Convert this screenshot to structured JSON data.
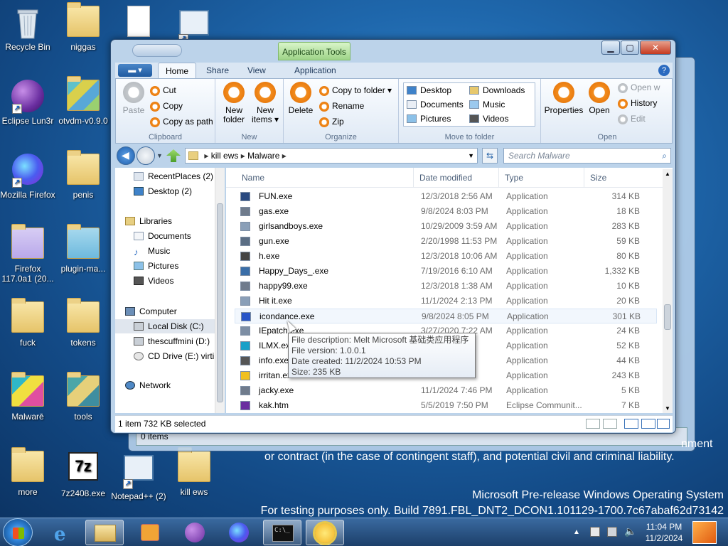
{
  "desktop": {
    "icons": [
      {
        "id": "recycle",
        "label": "Recycle Bin"
      },
      {
        "id": "niggas",
        "label": "niggas"
      },
      {
        "id": "eclipse",
        "label": "Eclipse Lun3r"
      },
      {
        "id": "otvdm",
        "label": "otvdm-v0.9.0"
      },
      {
        "id": "firefox",
        "label": "Mozilla Firefox"
      },
      {
        "id": "penis",
        "label": "penis"
      },
      {
        "id": "firefox117",
        "label": "Firefox 117.0a1 (20..."
      },
      {
        "id": "plugin",
        "label": "plugin-ma..."
      },
      {
        "id": "fuck",
        "label": "fuck"
      },
      {
        "id": "tokens",
        "label": "tokens"
      },
      {
        "id": "malware",
        "label": "Malwarē"
      },
      {
        "id": "tools",
        "label": "tools"
      },
      {
        "id": "more",
        "label": "more"
      },
      {
        "id": "7z",
        "label": "7z2408.exe"
      },
      {
        "id": "notepad",
        "label": "Notepad++ (2)"
      },
      {
        "id": "killews",
        "label": "kill ews"
      }
    ],
    "bg_status": "0 items",
    "bg_text_line1": "nment",
    "bg_text_line2": "or contract (in the case of contingent staff), and potential civil and criminal liability.",
    "watermark_line1": "Microsoft Pre-release Windows Operating System",
    "watermark_line2": "For testing purposes only. Build 7891.FBL_DNT2_DCON1.101129-1700.7c67abaf62d73142"
  },
  "window": {
    "context_tab": "Application Tools",
    "tabs": {
      "file": "▾",
      "home": "Home",
      "share": "Share",
      "view": "View",
      "application": "Application"
    },
    "clipboard": {
      "paste": "Paste",
      "cut": "Cut",
      "copy": "Copy",
      "copy_path": "Copy as path",
      "label": "Clipboard"
    },
    "new": {
      "folder": "New folder",
      "items": "New items ▾",
      "label": "New"
    },
    "organize": {
      "delete": "Delete",
      "copy_to": "Copy to folder ▾",
      "rename": "Rename",
      "zip": "Zip",
      "label": "Organize"
    },
    "move_to": {
      "desktop": "Desktop",
      "downloads": "Downloads",
      "documents": "Documents",
      "music": "Music",
      "pictures": "Pictures",
      "videos": "Videos",
      "label": "Move to folder"
    },
    "open": {
      "properties": "Properties",
      "open": "Open",
      "open_with": "Open w",
      "history": "History",
      "edit": "Edit",
      "label": "Open"
    },
    "path": {
      "part1": "kill ews",
      "part2": "Malware"
    },
    "search_placeholder": "Search Malware",
    "nav": {
      "recent": "RecentPlaces (2)",
      "desktop": "Desktop (2)",
      "libraries": "Libraries",
      "documents": "Documents",
      "music": "Music",
      "pictures": "Pictures",
      "videos": "Videos",
      "computer": "Computer",
      "local_disk": "Local Disk (C:)",
      "thescuff": "thescuffmini (D:)",
      "cd": "CD Drive (E:) virti",
      "network": "Network"
    },
    "columns": {
      "name": "Name",
      "date": "Date modified",
      "type": "Type",
      "size": "Size"
    },
    "files": [
      {
        "name": "FUN.exe",
        "date": "12/3/2018 2:56 AM",
        "type": "Application",
        "size": "314 KB"
      },
      {
        "name": "gas.exe",
        "date": "9/8/2024 8:03 PM",
        "type": "Application",
        "size": "18 KB"
      },
      {
        "name": "girlsandboys.exe",
        "date": "10/29/2009 3:59 AM",
        "type": "Application",
        "size": "283 KB"
      },
      {
        "name": "gun.exe",
        "date": "2/20/1998 11:53 PM",
        "type": "Application",
        "size": "59 KB"
      },
      {
        "name": "h.exe",
        "date": "12/3/2018 10:06 AM",
        "type": "Application",
        "size": "80 KB"
      },
      {
        "name": "Happy_Days_.exe",
        "date": "7/19/2016 6:10 AM",
        "type": "Application",
        "size": "1,332 KB"
      },
      {
        "name": "happy99.exe",
        "date": "12/3/2018 1:38 AM",
        "type": "Application",
        "size": "10 KB"
      },
      {
        "name": "Hit it.exe",
        "date": "11/1/2024 2:13 PM",
        "type": "Application",
        "size": "20 KB"
      },
      {
        "name": "icondance.exe",
        "date": "9/8/2024 8:05 PM",
        "type": "Application",
        "size": "301 KB"
      },
      {
        "name": "IEpatch.exe",
        "date": "3/27/2020 7:22 AM",
        "type": "Application",
        "size": "24 KB"
      },
      {
        "name": "ILMX.exe",
        "date": "",
        "type": "Application",
        "size": "52 KB"
      },
      {
        "name": "info.exe",
        "date": "",
        "type": "Application",
        "size": "44 KB"
      },
      {
        "name": "irritan.exe",
        "date": "",
        "type": "Application",
        "size": "243 KB"
      },
      {
        "name": "jacky.exe",
        "date": "11/1/2024 7:46 PM",
        "type": "Application",
        "size": "5 KB"
      },
      {
        "name": "kak.htm",
        "date": "5/5/2019 7:50 PM",
        "type": "Eclipse Communit...",
        "size": "7 KB"
      }
    ],
    "status": "1 item 732 KB selected",
    "tooltip": {
      "desc": "File description: Melt Microsoft 基础类应用程序",
      "version": "File version: 1.0.0.1",
      "created": "Date created: 11/2/2024 10:53 PM",
      "size": "Size: 235 KB"
    }
  },
  "taskbar": {
    "time": "11:04 PM",
    "date": "11/2/2024"
  }
}
